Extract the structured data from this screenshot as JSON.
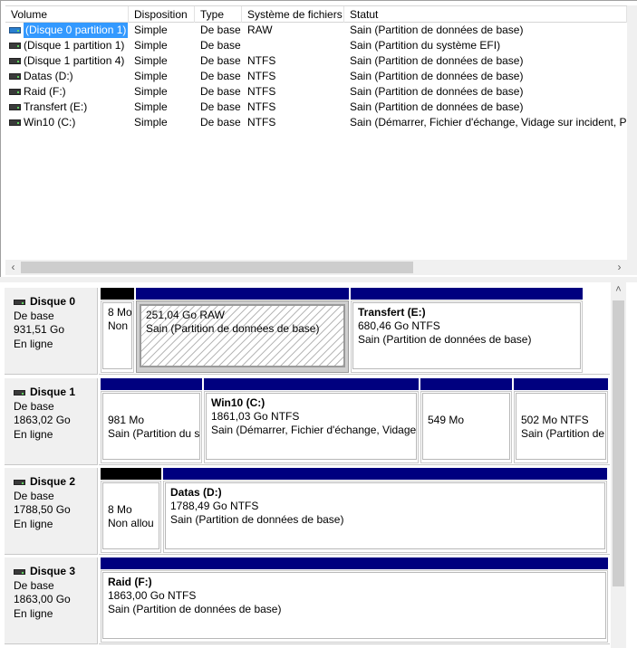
{
  "columns": [
    "Volume",
    "Disposition",
    "Type",
    "Système de fichiers",
    "Statut"
  ],
  "volumes": [
    {
      "volume": "(Disque 0 partition 1)",
      "disposition": "Simple",
      "type": "De base",
      "fs": "RAW",
      "status": "Sain (Partition de données de base)",
      "selected": true
    },
    {
      "volume": "(Disque 1 partition 1)",
      "disposition": "Simple",
      "type": "De base",
      "fs": "",
      "status": "Sain (Partition du système EFI)"
    },
    {
      "volume": "(Disque 1 partition 4)",
      "disposition": "Simple",
      "type": "De base",
      "fs": "NTFS",
      "status": "Sain (Partition de données de base)"
    },
    {
      "volume": "Datas (D:)",
      "disposition": "Simple",
      "type": "De base",
      "fs": "NTFS",
      "status": "Sain (Partition de données de base)"
    },
    {
      "volume": "Raid (F:)",
      "disposition": "Simple",
      "type": "De base",
      "fs": "NTFS",
      "status": "Sain (Partition de données de base)"
    },
    {
      "volume": "Transfert (E:)",
      "disposition": "Simple",
      "type": "De base",
      "fs": "NTFS",
      "status": "Sain (Partition de données de base)"
    },
    {
      "volume": "Win10 (C:)",
      "disposition": "Simple",
      "type": "De base",
      "fs": "NTFS",
      "status": "Sain (Démarrer, Fichier d'échange, Vidage sur incident, Par"
    }
  ],
  "disks": [
    {
      "name": "Disque 0",
      "type": "De base",
      "size": "931,51 Go",
      "state": "En ligne",
      "partitions": [
        {
          "title": "",
          "line1": "8 Mo",
          "line2": "Non",
          "kind": "unalloc"
        },
        {
          "title": "",
          "line1": "251,04 Go RAW",
          "line2": "Sain (Partition de données de base)",
          "kind": "selected"
        },
        {
          "title": "Transfert  (E:)",
          "line1": "680,46 Go NTFS",
          "line2": "Sain (Partition de données de base)",
          "kind": "primary"
        }
      ]
    },
    {
      "name": "Disque 1",
      "type": "De base",
      "size": "1863,02 Go",
      "state": "En ligne",
      "partitions": [
        {
          "title": "",
          "line1": "981 Mo",
          "line2": "Sain (Partition du s",
          "kind": "primary"
        },
        {
          "title": "Win10  (C:)",
          "line1": "1861,03 Go NTFS",
          "line2": "Sain (Démarrer, Fichier d'échange, Vidage",
          "kind": "primary"
        },
        {
          "title": "",
          "line1": "549 Mo",
          "line2": "",
          "kind": "primary"
        },
        {
          "title": "",
          "line1": "502 Mo NTFS",
          "line2": "Sain (Partition de",
          "kind": "primary"
        }
      ]
    },
    {
      "name": "Disque 2",
      "type": "De base",
      "size": "1788,50 Go",
      "state": "En ligne",
      "partitions": [
        {
          "title": "",
          "line1": "8 Mo",
          "line2": "Non allou",
          "kind": "unalloc"
        },
        {
          "title": "Datas  (D:)",
          "line1": "1788,49 Go NTFS",
          "line2": "Sain (Partition de données de base)",
          "kind": "primary"
        }
      ]
    },
    {
      "name": "Disque 3",
      "type": "De base",
      "size": "1863,00 Go",
      "state": "En ligne",
      "partitions": [
        {
          "title": "Raid  (F:)",
          "line1": "1863,00 Go NTFS",
          "line2": "Sain (Partition de données de base)",
          "kind": "primary"
        }
      ]
    }
  ],
  "colors": {
    "primary_bar": "#00007f",
    "unallocated_bar": "#000000",
    "selection": "#3399ff"
  }
}
